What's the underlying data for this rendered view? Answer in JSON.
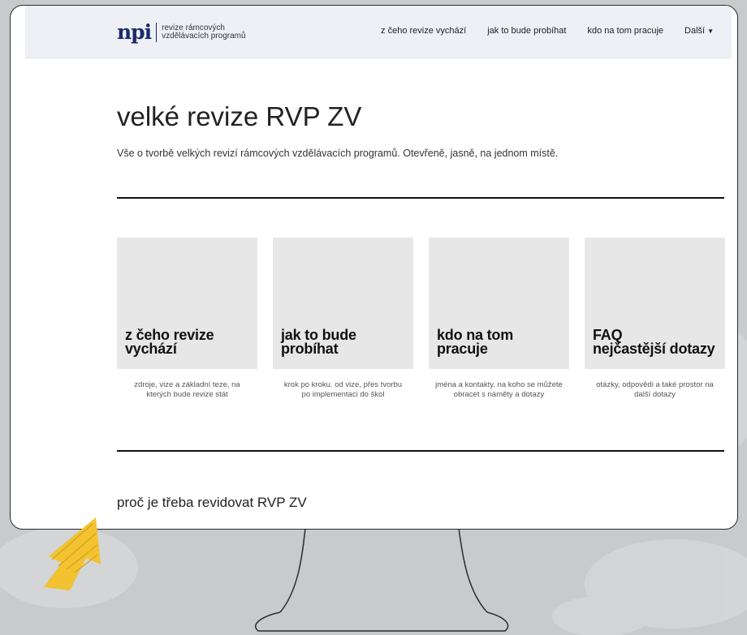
{
  "colors": {
    "nav_bg": "#eef0f5",
    "brand_navy": "#1c2a6b",
    "card_bg": "#e7e7e7",
    "arrow_yellow": "#f2c230",
    "background": "#c9cacb"
  },
  "header": {
    "logo_mark": "npi",
    "logo_line1": "revize rámcových",
    "logo_line2": "vzdělávacích programů",
    "nav": [
      {
        "label": "z čeho revize vychází"
      },
      {
        "label": "jak to bude probíhat"
      },
      {
        "label": "kdo na tom pracuje"
      },
      {
        "label": "Další",
        "icon": "chevron-down-icon"
      }
    ]
  },
  "hero": {
    "title": "velké revize RVP ZV",
    "subtitle": "Vše o tvorbě velkých revizí rámcových vzdělávacích programů. Otevřeně, jasně, na jednom místě."
  },
  "cards": [
    {
      "title_line1": "z čeho revize",
      "title_line2": "vychází",
      "desc_line1": "zdroje, vize a základní teze, na",
      "desc_line2": "kterých bude revize stát"
    },
    {
      "title_line1": "jak to bude",
      "title_line2": "probíhat",
      "desc_line1": "krok po kroku. od vize, přes tvorbu",
      "desc_line2": "po implementaci do škol"
    },
    {
      "title_line1": "kdo na tom",
      "title_line2": "pracuje",
      "desc_line1": "jména a kontakty. na koho se můžete",
      "desc_line2": "obracet s náměty a dotazy"
    },
    {
      "title_line1": "FAQ",
      "title_line2": "nejčastější dotazy",
      "desc_line1": "otázky, odpovědi a také prostor na",
      "desc_line2": "další dotazy"
    }
  ],
  "section": {
    "heading": "proč je třeba revidovat RVP ZV"
  }
}
